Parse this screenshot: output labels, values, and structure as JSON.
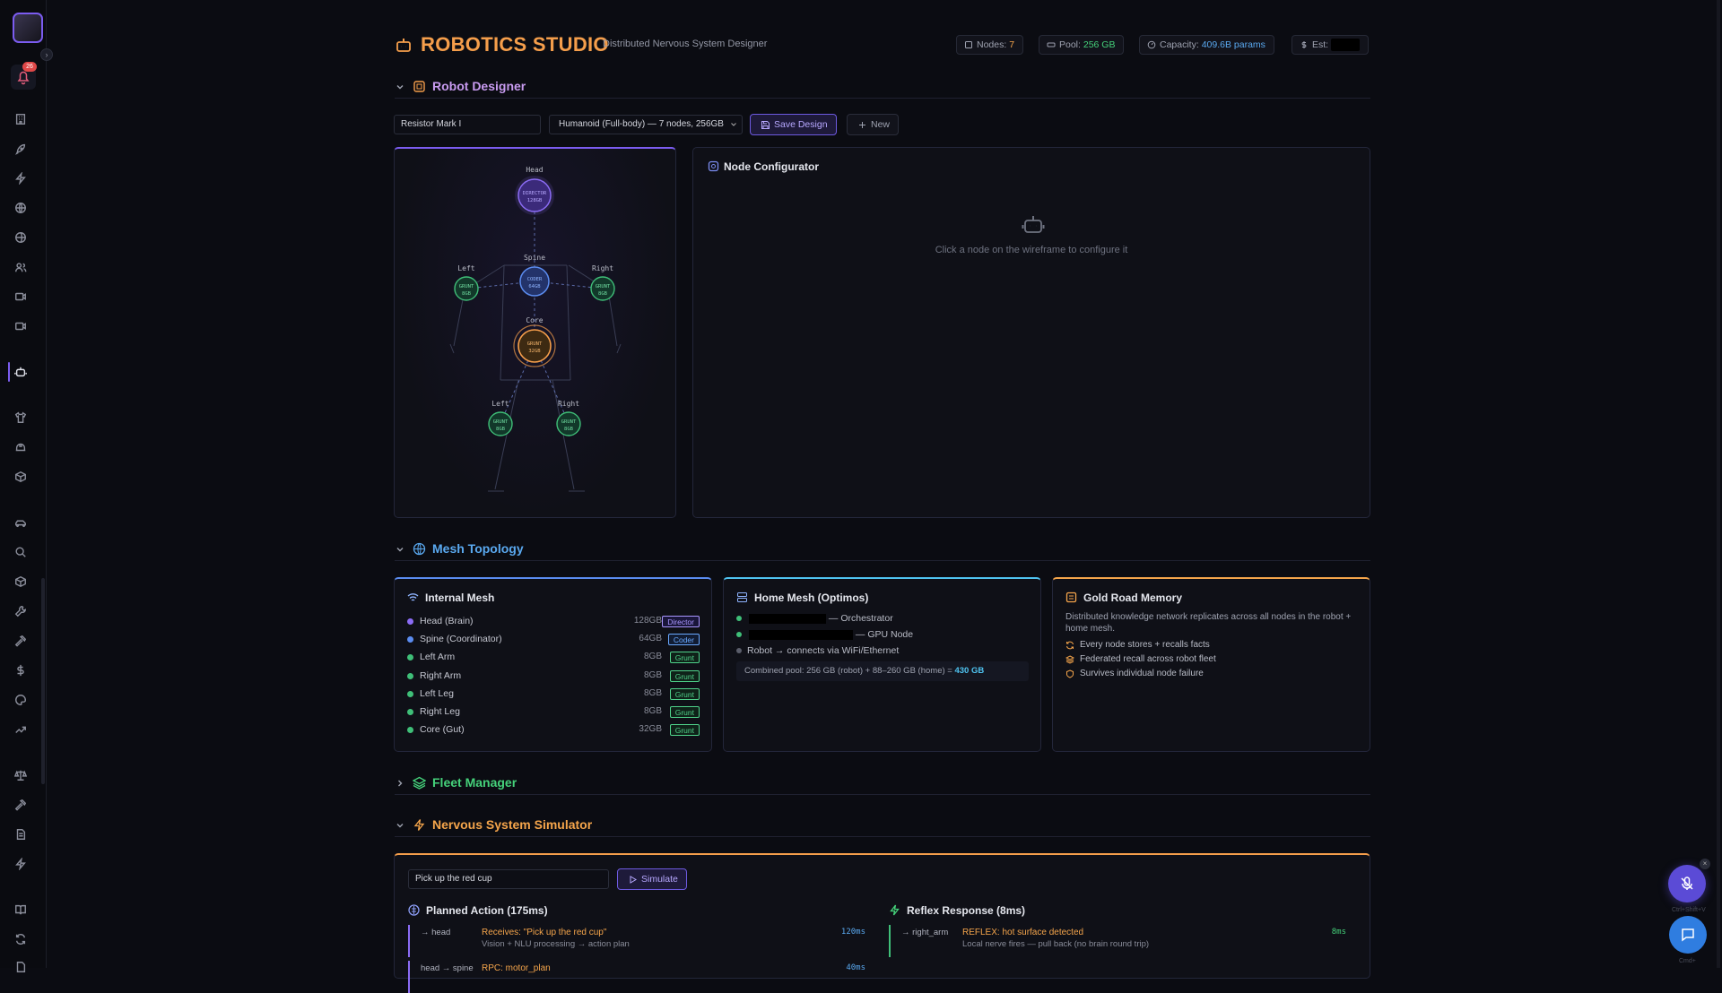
{
  "header": {
    "title": "ROBOTICS STUDIO",
    "subtitle": "Distributed Nervous System Designer",
    "stats": [
      {
        "label": "Nodes:",
        "value": "7"
      },
      {
        "label": "Pool:",
        "value": "256 GB"
      },
      {
        "label": "Capacity:",
        "value": "409.6B params"
      },
      {
        "label": "Est:",
        "value": ""
      }
    ]
  },
  "sidebar": {
    "notification_badge": "26"
  },
  "robot_designer": {
    "section_title": "Robot Designer",
    "name_value": "Resistor Mark I",
    "body_select": "Humanoid (Full-body) — 7 nodes, 256GB",
    "save_label": "Save Design",
    "new_label": "New",
    "wireframe": {
      "nodes": [
        {
          "label": "Head",
          "role": "DIRECTOR",
          "size": "128GB"
        },
        {
          "label": "Spine",
          "role": "CODER",
          "size": "64GB"
        },
        {
          "label": "Left",
          "role": "GRUNT",
          "size": "8GB"
        },
        {
          "label": "Right",
          "role": "GRUNT",
          "size": "8GB"
        },
        {
          "label": "Core",
          "role": "GRUNT",
          "size": "32GB"
        },
        {
          "label": "Left",
          "role": "GRUNT",
          "size": "8GB"
        },
        {
          "label": "Right",
          "role": "GRUNT",
          "size": "8GB"
        }
      ]
    },
    "configurator": {
      "title": "Node Configurator",
      "hint": "Click a node on the wireframe to configure it"
    }
  },
  "mesh_topology": {
    "section_title": "Mesh Topology",
    "internal": {
      "title": "Internal Mesh",
      "rows": [
        {
          "name": "Head (Brain)",
          "size": "128GB",
          "role": "Director",
          "color": "#8b6cf5"
        },
        {
          "name": "Spine (Coordinator)",
          "size": "64GB",
          "role": "Coder",
          "color": "#5b8cf0"
        },
        {
          "name": "Left Arm",
          "size": "8GB",
          "role": "Grunt",
          "color": "#3fbf78"
        },
        {
          "name": "Right Arm",
          "size": "8GB",
          "role": "Grunt",
          "color": "#3fbf78"
        },
        {
          "name": "Left Leg",
          "size": "8GB",
          "role": "Grunt",
          "color": "#3fbf78"
        },
        {
          "name": "Right Leg",
          "size": "8GB",
          "role": "Grunt",
          "color": "#3fbf78"
        },
        {
          "name": "Core (Gut)",
          "size": "32GB",
          "role": "Grunt",
          "color": "#3fbf78"
        }
      ]
    },
    "home": {
      "title": "Home Mesh (Optimos)",
      "rows": [
        "— Orchestrator",
        "— GPU Node",
        "Robot → connects via WiFi/Ethernet"
      ],
      "pool_text": "Combined pool: 256 GB (robot) + 88–260 GB (home) =",
      "pool_total": "430 GB"
    },
    "gold": {
      "title": "Gold Road Memory",
      "desc": "Distributed knowledge network replicates across all nodes in the robot + home mesh.",
      "items": [
        "Every node stores + recalls facts",
        "Federated recall across robot fleet",
        "Survives individual node failure"
      ]
    }
  },
  "fleet_manager": {
    "section_title": "Fleet Manager"
  },
  "nervous_system": {
    "section_title": "Nervous System Simulator",
    "command_value": "Pick up the red cup",
    "simulate_label": "Simulate",
    "planned": {
      "title": "Planned Action (175ms)",
      "steps": [
        {
          "node": "→ head",
          "msg": "Receives: \"Pick up the red cup\"",
          "sub": "Vision + NLU processing → action plan",
          "ms": "120ms"
        },
        {
          "node": "head → spine",
          "msg": "RPC: motor_plan",
          "sub": "",
          "ms": "40ms"
        }
      ]
    },
    "reflex": {
      "title": "Reflex Response (8ms)",
      "steps": [
        {
          "node": "→ right_arm",
          "msg": "REFLEX: hot surface detected",
          "sub": "Local nerve fires — pull back (no brain round trip)",
          "ms": "8ms"
        }
      ]
    }
  },
  "floating": {
    "mic_hint": "Ctrl+Shift+V",
    "chat_hint": "Cmd+"
  }
}
